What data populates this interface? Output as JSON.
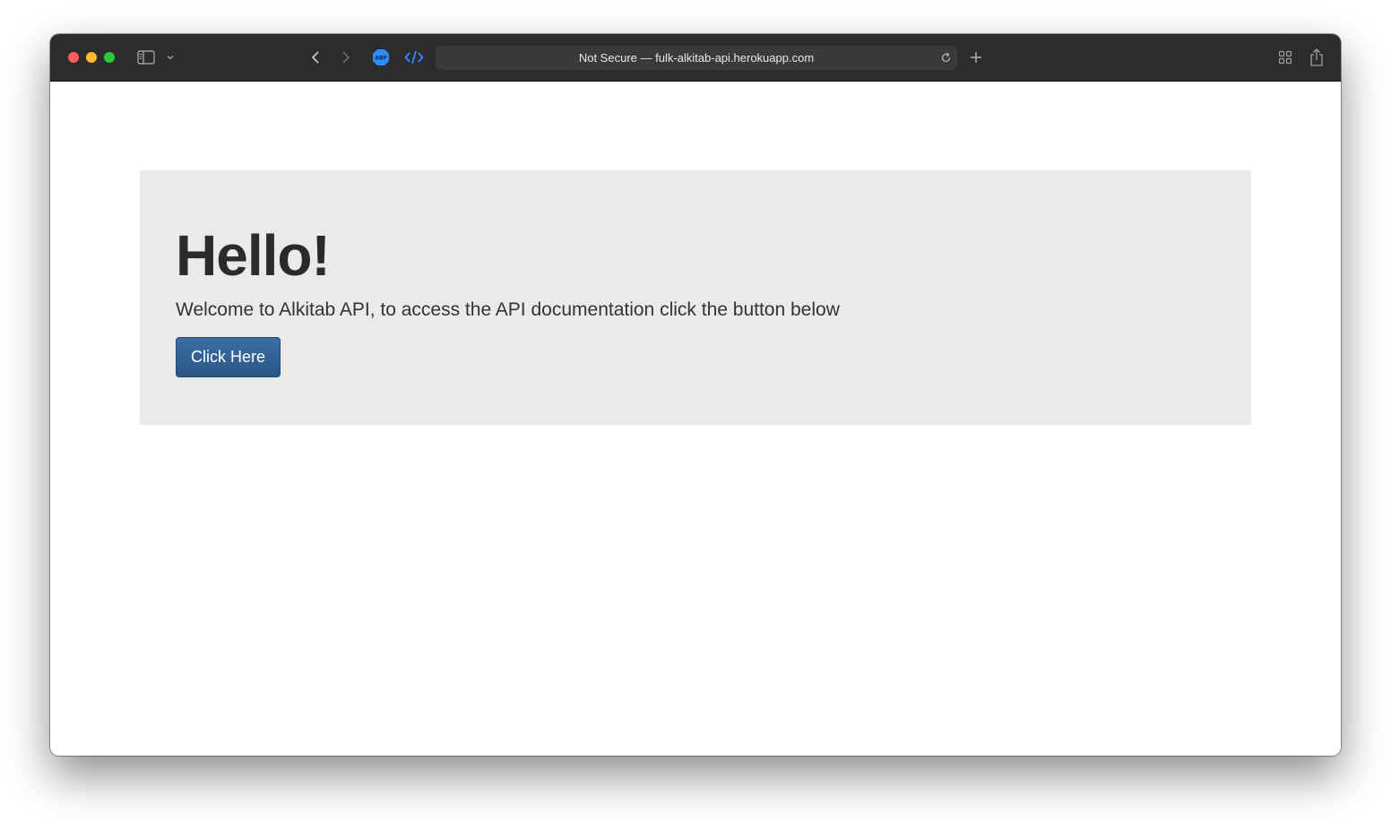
{
  "browser": {
    "address_prefix": "Not Secure — ",
    "address_host": "fulk-alkitab-api.herokuapp.com",
    "accent_color": "#2f8cff"
  },
  "page": {
    "title": "Hello!",
    "subtitle": "Welcome to Alkitab API, to access the API documentation click the button below",
    "button_label": "Click Here",
    "button_color": "#2a5686",
    "panel_color": "#eaeaea"
  },
  "icons": {
    "sidebar": "sidebar-icon",
    "chevron": "chevron-down-icon",
    "back": "back-arrow-icon",
    "forward": "forward-arrow-icon",
    "adblock": "adblock-icon",
    "devtools": "code-icon",
    "reload": "reload-icon",
    "new_tab": "plus-icon",
    "tab_overview": "tab-overview-icon",
    "share": "share-icon"
  }
}
